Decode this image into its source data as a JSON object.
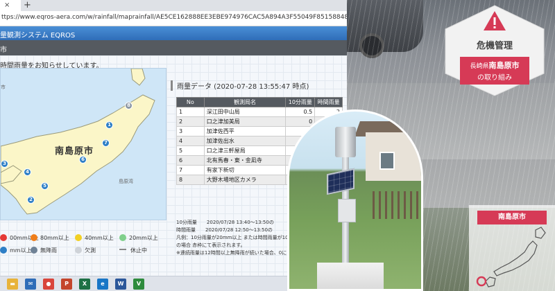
{
  "browser": {
    "tab_close": "×",
    "new_tab": "+",
    "url": "ttps://www.eqros-aera.com/w/rainfall/maprainfall/AE5CE162888EE3EBE974976CAC5A894A3F55049F8515884883D579F83FA378D"
  },
  "app": {
    "title": "量観測システム EQROS",
    "subnav": "市",
    "notice": "時間雨量をお知らせしています。"
  },
  "map": {
    "city_label": "南島原市",
    "note_top": "市",
    "note_right": "島原湾",
    "markers": [
      {
        "label": "8",
        "kind": "grey"
      },
      {
        "label": "1",
        "kind": "blue"
      },
      {
        "label": "7",
        "kind": "blue"
      },
      {
        "label": "6",
        "kind": "blue"
      },
      {
        "label": "4",
        "kind": "blue"
      },
      {
        "label": "5",
        "kind": "blue"
      },
      {
        "label": "2",
        "kind": "blue"
      },
      {
        "label": "3",
        "kind": "blue"
      }
    ]
  },
  "legend": [
    {
      "label": "00mm以上",
      "color": "#e53935"
    },
    {
      "label": "80mm以上",
      "color": "#ef7d1a"
    },
    {
      "label": "40mm以上",
      "color": "#f2d024"
    },
    {
      "label": "20mm以上",
      "color": "#7fcf8b"
    },
    {
      "label": "mm以上",
      "color": "#2e7fc6"
    },
    {
      "label": "無降雨",
      "color": "#6f8296"
    },
    {
      "label": "欠測",
      "color": "#cfd3d8"
    },
    {
      "label": "休止中",
      "color": "#888888"
    }
  ],
  "rain_panel": {
    "title": "雨量データ (2020-07-28 13:55:47 時点)",
    "headers": [
      "No",
      "観測局名",
      "10分雨量",
      "時間雨量"
    ],
    "rows": [
      {
        "no": "1",
        "name": "深江田中山局",
        "r10": "0.5",
        "r60": "2"
      },
      {
        "no": "2",
        "name": "口之津加美局",
        "r10": "0",
        "r60": ""
      },
      {
        "no": "3",
        "name": "加津佐西平",
        "r10": "0",
        "r60": ""
      },
      {
        "no": "4",
        "name": "加津佐出水",
        "r10": "",
        "r60": ""
      },
      {
        "no": "5",
        "name": "口之津三軒屋局",
        "r10": "",
        "r60": ""
      },
      {
        "no": "6",
        "name": "北有馬春・東・金凪寺",
        "r10": "",
        "r60": ""
      },
      {
        "no": "7",
        "name": "有家下新切",
        "r10": "",
        "r60": ""
      },
      {
        "no": "8",
        "name": "大野木場地区カメラ",
        "r10": "",
        "r60": ""
      }
    ],
    "footnotes": [
      "10分雨量　　2020/07/28 13:40～13:50の",
      "時間雨量　　2020/07/28 12:50～13:50の",
      "凡例：10分雨量が20mm以上 または時間雨量が10",
      "の場合 赤枠にて表示されます。",
      "※連続雨量は12時間以上無降雨が続いた場合、0に"
    ]
  },
  "taskbar": {
    "icons": [
      {
        "name": "file-explorer-icon",
        "glyph": "▬",
        "color": "#e8b33a"
      },
      {
        "name": "mail-icon",
        "glyph": "✉",
        "color": "#2f6db8"
      },
      {
        "name": "chrome-icon",
        "glyph": "●",
        "color": "#d9453b"
      },
      {
        "name": "powerpoint-icon",
        "glyph": "P",
        "color": "#c4452c"
      },
      {
        "name": "excel-icon",
        "glyph": "X",
        "color": "#1e7145"
      },
      {
        "name": "edge-icon",
        "glyph": "e",
        "color": "#1976c6"
      },
      {
        "name": "word-icon",
        "glyph": "W",
        "color": "#2b579a"
      },
      {
        "name": "v-app-icon",
        "glyph": "V",
        "color": "#2e8b3d"
      }
    ]
  },
  "badge": {
    "label": "危機管理",
    "pref": "長崎県",
    "city": "南島原市",
    "sub": "の取り組み",
    "colors": {
      "accent": "#d63a56",
      "hex_bg": "#f2f2f2"
    }
  },
  "jp_card": {
    "label": "南島原市"
  }
}
